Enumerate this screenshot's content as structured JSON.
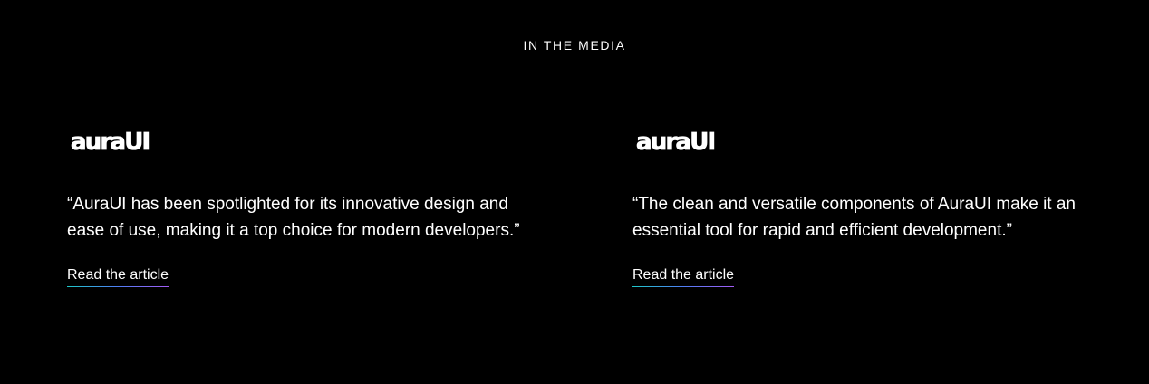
{
  "section": {
    "title": "IN THE MEDIA"
  },
  "articles": [
    {
      "logo_text": "auraUI",
      "quote": "“AuraUI has been spotlighted for its innovative design and ease of use, making it a top choice for modern developers.”",
      "link_label": "Read the article"
    },
    {
      "logo_text": "auraUI",
      "quote": "“The clean and versatile components of AuraUI make it an essential tool for rapid and efficient development.”",
      "link_label": "Read the article"
    }
  ],
  "colors": {
    "background": "#000000",
    "text": "#ffffff",
    "link_underline_start": "#1ec8c8",
    "link_underline_mid": "#4f7df5",
    "link_underline_end": "#a35cf5"
  }
}
